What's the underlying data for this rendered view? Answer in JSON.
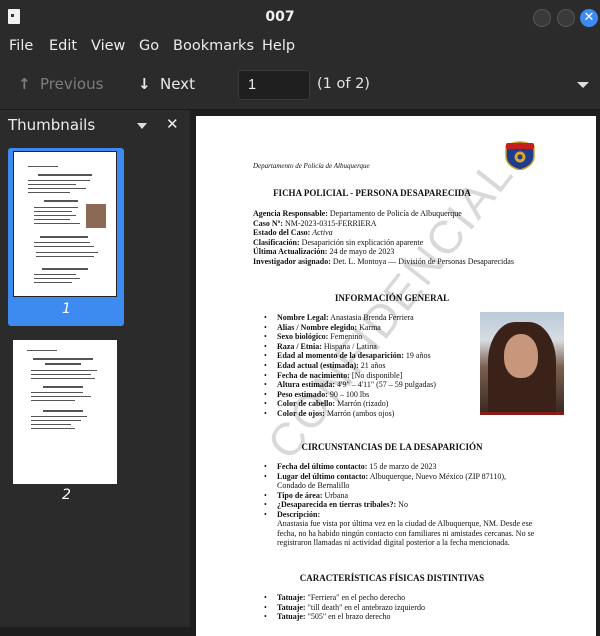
{
  "window": {
    "title": "007"
  },
  "menu": [
    "File",
    "Edit",
    "View",
    "Go",
    "Bookmarks",
    "Help"
  ],
  "toolbar": {
    "previous": "Previous",
    "next": "Next",
    "page_value": "1",
    "page_count": "(1 of 2)"
  },
  "sidebar": {
    "header": "Thumbnails",
    "thumbnails": [
      {
        "label": "1",
        "selected": true
      },
      {
        "label": "2",
        "selected": false
      }
    ]
  },
  "icons": {
    "app": "document-icon",
    "minimize": "minimize-icon",
    "maximize": "maximize-icon",
    "close": "close-icon",
    "prev": "arrow-up-icon",
    "next": "arrow-down-icon",
    "menu": "chevron-down-icon",
    "badge": "police-badge-icon"
  },
  "colors": {
    "accent": "#3d8bf0",
    "chrome": "#2b2b2b",
    "background": "#1e1e1e"
  },
  "document": {
    "dept": "Departamento de Policía de Albuquerque",
    "title": "FICHA POLICIAL - PERSONA DESAPARECIDA",
    "header_lines": [
      {
        "key": "Agencia Responsable:",
        "value": " Departamento de Policía de Albuquerque",
        "italic": false
      },
      {
        "key": "Caso Nº:",
        "value": " NM-2023-0315-FERRIERA",
        "italic": false
      },
      {
        "key": "Estado del Caso:",
        "value": " Activa",
        "italic": true
      },
      {
        "key": "Clasificación:",
        "value": " Desaparición sin explicación aparente",
        "italic": false
      },
      {
        "key": "Última Actualización:",
        "value": " 24 de mayo de 2023",
        "italic": false
      },
      {
        "key": "Investigador asignado:",
        "value": " Det. L. Montoya — División de Personas Desaparecidas",
        "italic": false
      }
    ],
    "general_title": "INFORMACIÓN GENERAL",
    "general": [
      {
        "key": "Nombre Legal:",
        "value": " Anastasia Brenda Ferriera"
      },
      {
        "key": "Alias / Nombre elegido:",
        "value": " Karma"
      },
      {
        "key": "Sexo biológico:",
        "value": " Femenino"
      },
      {
        "key": "Raza / Etnia:",
        "value": " Hispana / Latina"
      },
      {
        "key": "Edad al momento de la desaparición:",
        "value": " 19 años"
      },
      {
        "key": "Edad actual (estimada):",
        "value": " 21 años"
      },
      {
        "key": "Fecha de nacimiento:",
        "value": " [No disponible]"
      },
      {
        "key": "Altura estimada:",
        "value": " 4'9\" – 4'11\" (57 – 59 pulgadas)"
      },
      {
        "key": "Peso estimado:",
        "value": " 90 – 100 lbs"
      },
      {
        "key": "Color de cabello:",
        "value": " Marrón (rizado)"
      },
      {
        "key": "Color de ojos:",
        "value": " Marrón (ambos ojos)"
      }
    ],
    "circ_title": "CIRCUNSTANCIAS DE LA DESAPARICIÓN",
    "circ": [
      {
        "key": "Fecha del último contacto:",
        "value": " 15 de marzo de 2023"
      },
      {
        "key": "Lugar del último contacto:",
        "value": " Albuquerque, Nuevo México (ZIP 87110),"
      },
      {
        "key": "",
        "value": "Condado de Bernalillo"
      },
      {
        "key": "Tipo de área:",
        "value": " Urbana"
      },
      {
        "key": "¿Desaparecida en tierras tribales?:",
        "value": " No"
      },
      {
        "key": "Descripción:",
        "value": ""
      }
    ],
    "description": [
      "Anastasia fue vista por última vez en la ciudad de Albuquerque, NM. Desde ese",
      "fecha, no ha habido ningún contacto con familiares ni amistades cercanas. No se",
      "registraron llamadas ni actividad digital posterior a la fecha mencionada."
    ],
    "marks_title": "CARACTERÍSTICAS FÍSICAS DISTINTIVAS",
    "marks": [
      {
        "key": "Tatuaje:",
        "value": " \"Ferriera\" en el pecho derecho"
      },
      {
        "key": "Tatuaje:",
        "value": " \"till death\" en el antebrazo izquierdo"
      },
      {
        "key": "Tatuaje:",
        "value": " \"505\" en el brazo derecho"
      }
    ],
    "watermark": "CONFIDENCIAL"
  }
}
